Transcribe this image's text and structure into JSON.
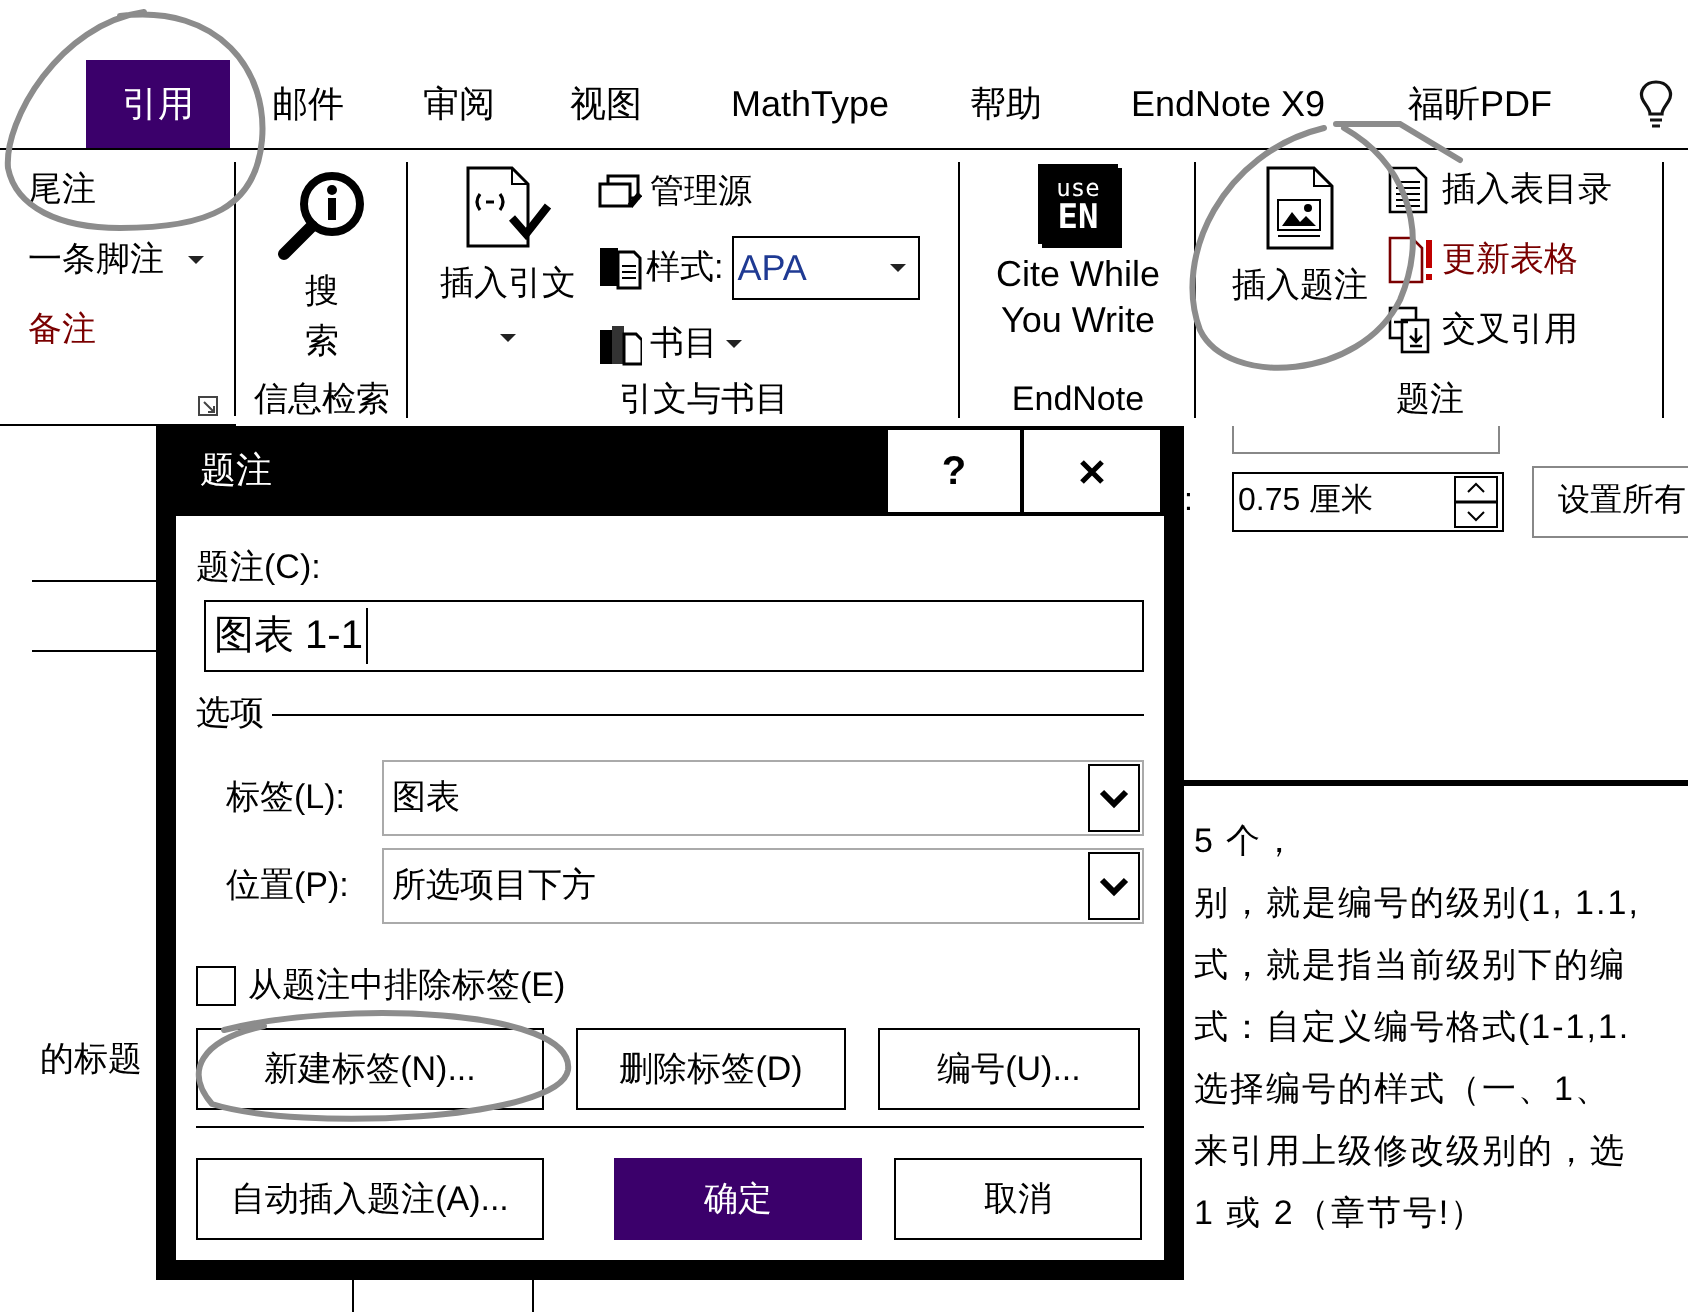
{
  "ribbon_tabs": [
    {
      "label": "引用",
      "selected": true
    },
    {
      "label": "邮件",
      "selected": false
    },
    {
      "label": "审阅",
      "selected": false
    },
    {
      "label": "视图",
      "selected": false
    },
    {
      "label": "MathType",
      "selected": false
    },
    {
      "label": "帮助",
      "selected": false
    },
    {
      "label": "EndNote X9",
      "selected": false
    },
    {
      "label": "福昕PDF",
      "selected": false
    }
  ],
  "footnotes_group": {
    "items": [
      {
        "label": "尾注",
        "kind": "plain"
      },
      {
        "label": "一条脚注",
        "kind": "dropdown"
      },
      {
        "label": "备注",
        "kind": "alert"
      }
    ]
  },
  "research_group": {
    "button": "搜索",
    "label": "信息检索"
  },
  "citations_group": {
    "insert_citation": "插入引文",
    "manage_sources": "管理源",
    "style_label": "样式:",
    "style_value": "APA",
    "bibliography": "书目",
    "label": "引文与书目"
  },
  "endnote_group": {
    "logo_top": "use",
    "logo_bottom": "EN",
    "button": "Cite While You Write",
    "label": "EndNote"
  },
  "captions_group": {
    "insert_caption": "插入题注",
    "items": [
      {
        "label": "插入表目录",
        "kind": "table_of_figures"
      },
      {
        "label": "更新表格",
        "kind": "update"
      },
      {
        "label": "交叉引用",
        "kind": "cross_reference"
      }
    ],
    "label": "题注"
  },
  "document": {
    "left_text": "的标题",
    "spin_label": ":",
    "spin_value": "0.75 厘米",
    "side_button": "设置所有",
    "body_lines": [
      "5 个，",
      "别，就是编号的级别(1, 1.1,",
      "式，就是指当前级别下的编",
      "式：自定义编号格式(1-1,1.",
      "选择编号的样式（一、1、",
      "来引用上级修改级别的，选",
      "1 或 2（章节号!）"
    ]
  },
  "dialog": {
    "title": "题注",
    "help": "?",
    "caption_label": "题注(C):",
    "caption_value": "图表 1-1",
    "options_legend": "选项",
    "fields": [
      {
        "label": "标签(L):",
        "value": "图表"
      },
      {
        "label": "位置(P):",
        "value": "所选项目下方"
      }
    ],
    "exclude_label": {
      "label": "从题注中排除标签(E)",
      "checked": false
    },
    "label_buttons": [
      {
        "label": "新建标签(N)...",
        "kind": "default"
      },
      {
        "label": "删除标签(D)",
        "kind": "default"
      },
      {
        "label": "编号(U)...",
        "kind": "default"
      }
    ],
    "action_buttons": [
      {
        "label": "自动插入题注(A)...",
        "kind": "default"
      },
      {
        "label": "确定",
        "kind": "primary"
      },
      {
        "label": "取消",
        "kind": "default"
      }
    ]
  }
}
